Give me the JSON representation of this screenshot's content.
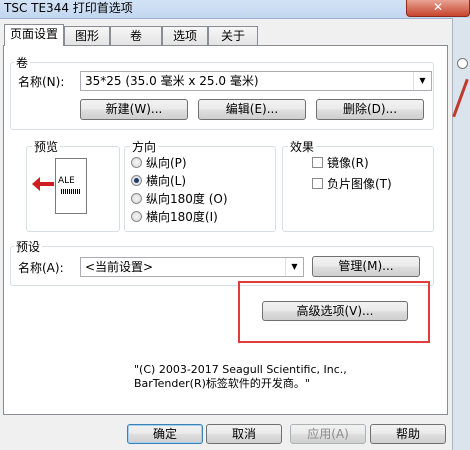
{
  "window": {
    "title": "TSC TE344 打印首选项"
  },
  "tabs": [
    {
      "label": "页面设置",
      "active": true
    },
    {
      "label": "图形",
      "active": false
    },
    {
      "label": "卷",
      "active": false
    },
    {
      "label": "选项",
      "active": false
    },
    {
      "label": "关于",
      "active": false
    }
  ],
  "stock": {
    "group_label": "卷",
    "name_label": "名称(N):",
    "name_value": "35*25 (35.0 毫米 x 25.0 毫米)",
    "new_button": "新建(W)...",
    "edit_button": "编辑(E)...",
    "delete_button": "删除(D)..."
  },
  "preview": {
    "group_label": "预览",
    "sample_text": "ALE"
  },
  "orientation": {
    "group_label": "方向",
    "options": [
      {
        "label": "纵向(P)",
        "selected": false
      },
      {
        "label": "横向(L)",
        "selected": true
      },
      {
        "label": "纵向180度 (O)",
        "selected": false
      },
      {
        "label": "横向180度(I)",
        "selected": false
      }
    ]
  },
  "effects": {
    "group_label": "效果",
    "options": [
      {
        "label": "镜像(R)",
        "checked": false
      },
      {
        "label": "负片图像(T)",
        "checked": false
      }
    ]
  },
  "preset": {
    "group_label": "预设",
    "name_label": "名称(A):",
    "name_value": "<当前设置>",
    "manage_button": "管理(M)..."
  },
  "advanced_button": "高级选项(V)...",
  "copyright": "\"(C) 2003-2017 Seagull Scientific, Inc.,\nBarTender(R)标签软件的开发商。\"",
  "footer": {
    "ok": "确定",
    "cancel": "取消",
    "apply": "应用(A)",
    "help": "帮助"
  },
  "colors": {
    "highlight_frame": "#e23b3b",
    "arrow_red": "#cc1f1f"
  }
}
